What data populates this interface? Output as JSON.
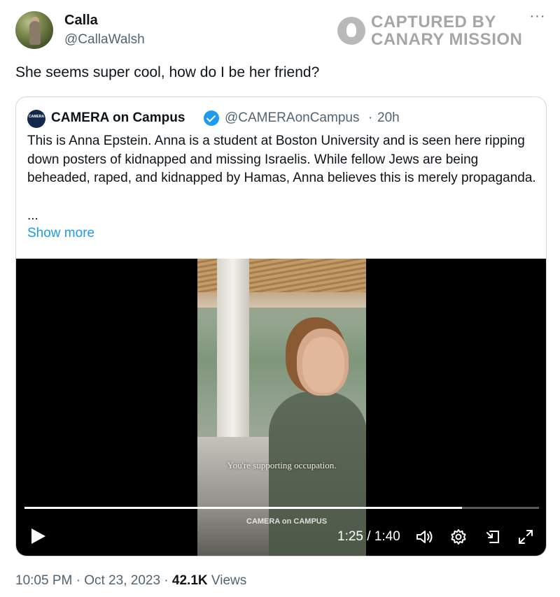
{
  "author": {
    "display_name": "Calla",
    "handle": "@CallaWalsh"
  },
  "watermark": {
    "line1": "CAPTURED BY",
    "line2": "CANARY MISSION"
  },
  "more_label": "···",
  "tweet_text": "She seems super cool, how do I be her friend?",
  "quote": {
    "avatar_text": "CAMERA on CAMPUS",
    "name": "CAMERA on Campus",
    "handle": "@CAMERAonCampus",
    "separator": "·",
    "time": "20h",
    "body": "This is Anna Epstein. Anna is a student at Boston University and is seen here ripping down posters of kidnapped and missing Israelis. While fellow Jews are being beheaded, raped, and kidnapped by Hamas, Anna believes this is merely propaganda.",
    "ellipsis": "...",
    "show_more": "Show more"
  },
  "video": {
    "caption": "You're supporting occupation.",
    "watermark": "CAMERA on CAMPUS",
    "current_time": "1:25",
    "duration": "1:40",
    "time_display": "1:25 / 1:40",
    "progress": 0.85
  },
  "meta": {
    "time": "10:05 PM",
    "sep1": "·",
    "date": "Oct 23, 2023",
    "sep2": "·",
    "views_count": "42.1K",
    "views_label": "Views"
  },
  "icons": [
    "play-icon",
    "volume-icon",
    "settings-icon",
    "pip-icon",
    "fullscreen-icon",
    "verified-badge-icon",
    "more-icon"
  ],
  "colors": {
    "accent": "#1d9bf0",
    "text": "#0f1419",
    "secondary": "#536471",
    "border": "#cfd9de"
  }
}
